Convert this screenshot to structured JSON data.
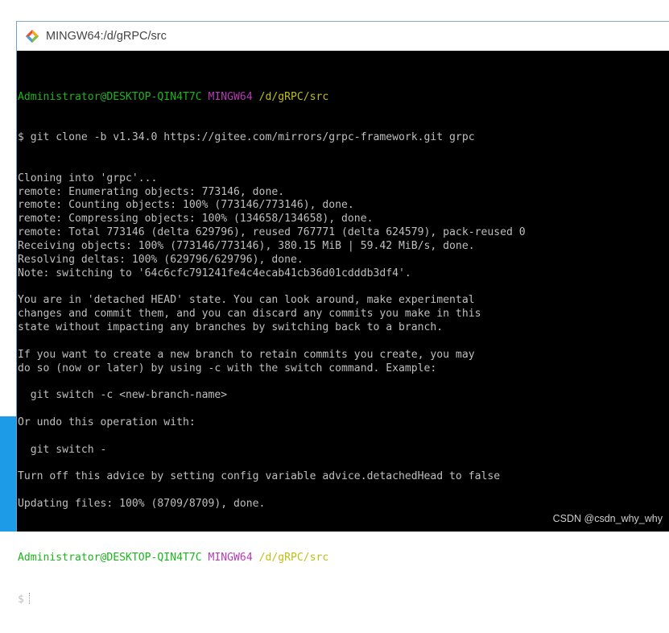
{
  "window": {
    "title": "MINGW64:/d/gRPC/src"
  },
  "prompt": {
    "user_host": "Administrator@DESKTOP-QIN4T7C",
    "env": "MINGW64",
    "path": "/d/gRPC/src",
    "symbol": "$"
  },
  "command": "$ git clone -b v1.34.0 https://gitee.com/mirrors/grpc-framework.git grpc",
  "output": [
    "Cloning into 'grpc'...",
    "remote: Enumerating objects: 773146, done.",
    "remote: Counting objects: 100% (773146/773146), done.",
    "remote: Compressing objects: 100% (134658/134658), done.",
    "remote: Total 773146 (delta 629796), reused 767771 (delta 624579), pack-reused 0",
    "Receiving objects: 100% (773146/773146), 380.15 MiB | 59.42 MiB/s, done.",
    "Resolving deltas: 100% (629796/629796), done.",
    "Note: switching to '64c6cfc791241fe4c4ecab41cb36d01cdddb3df4'.",
    "",
    "You are in 'detached HEAD' state. You can look around, make experimental",
    "changes and commit them, and you can discard any commits you make in this",
    "state without impacting any branches by switching back to a branch.",
    "",
    "If you want to create a new branch to retain commits you create, you may",
    "do so (now or later) by using -c with the switch command. Example:",
    "",
    "  git switch -c <new-branch-name>",
    "",
    "Or undo this operation with:",
    "",
    "  git switch -",
    "",
    "Turn off this advice by setting config variable advice.detachedHead to false",
    "",
    "Updating files: 100% (8709/8709), done.",
    ""
  ],
  "watermark": "CSDN @csdn_why_why",
  "colors": {
    "terminal_bg": "#000000",
    "text": "#bfbfbf",
    "user_host": "#1cb51c",
    "env": "#b43cb4",
    "path": "#bfbf19"
  },
  "icons": {
    "title_icon": "git-diamond-icon"
  }
}
